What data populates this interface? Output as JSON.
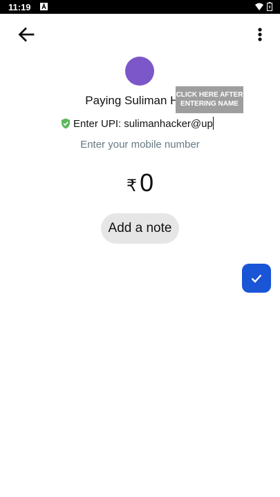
{
  "status_bar": {
    "time": "11:19"
  },
  "payee": {
    "paying_text": "Paying Suliman Hacker",
    "avatar_color": "#7c57c9"
  },
  "helper_button": {
    "label_line1": "CLICK HERE AFTER",
    "label_line2": "ENTERING NAME"
  },
  "upi": {
    "label": "Enter UPI:",
    "value": "sulimanhacker@up"
  },
  "mobile": {
    "hint": "Enter your mobile number"
  },
  "amount": {
    "currency_symbol": "₹",
    "value": "0"
  },
  "note": {
    "label": "Add a note"
  },
  "colors": {
    "accent": "#1a55d6",
    "shield": "#5cb85c",
    "helper": "#9e9e9e"
  },
  "icons": {
    "back": "arrow-left-icon",
    "more": "more-vertical-icon",
    "verified": "shield-check-icon",
    "confirm": "check-icon"
  }
}
